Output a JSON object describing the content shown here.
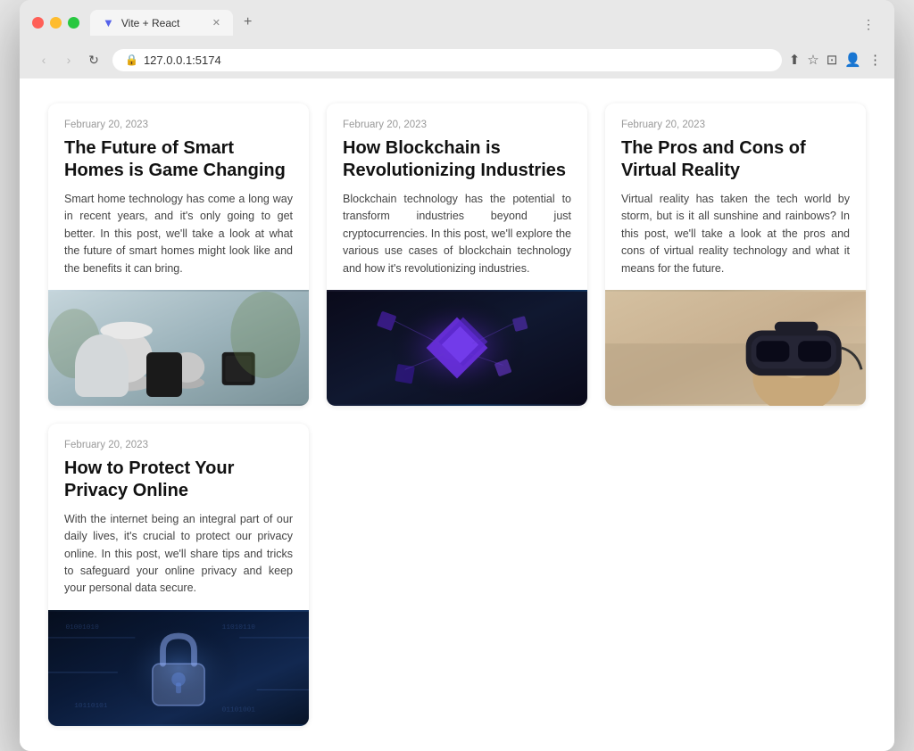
{
  "browser": {
    "tab_title": "Vite + React",
    "tab_favicon": "▼",
    "url": "127.0.0.1:5174",
    "protocol_icon": "🔒",
    "new_tab_label": "+",
    "more_options_label": "⋮"
  },
  "nav": {
    "back_label": "‹",
    "forward_label": "›",
    "refresh_label": "↻"
  },
  "toolbar": {
    "share_label": "⬆",
    "bookmark_label": "☆",
    "split_view_label": "⊡",
    "profile_label": "👤",
    "overflow_label": "⋮"
  },
  "posts": [
    {
      "date": "February 20, 2023",
      "title": "The Future of Smart Homes is Game Changing",
      "excerpt": "Smart home technology has come a long way in recent years, and it's only going to get better. In this post, we'll take a look at what the future of smart homes might look like and the benefits it can bring.",
      "image_type": "smart-home"
    },
    {
      "date": "February 20, 2023",
      "title": "How Blockchain is Revolutionizing Industries",
      "excerpt": "Blockchain technology has the potential to transform industries beyond just cryptocurrencies. In this post, we'll explore the various use cases of blockchain technology and how it's revolutionizing industries.",
      "image_type": "blockchain"
    },
    {
      "date": "February 20, 2023",
      "title": "The Pros and Cons of Virtual Reality",
      "excerpt": "Virtual reality has taken the tech world by storm, but is it all sunshine and rainbows? In this post, we'll take a look at the pros and cons of virtual reality technology and what it means for the future.",
      "image_type": "vr"
    },
    {
      "date": "February 20, 2023",
      "title": "How to Protect Your Privacy Online",
      "excerpt": "With the internet being an integral part of our daily lives, it's crucial to protect our privacy online. In this post, we'll share tips and tricks to safeguard your online privacy and keep your personal data secure.",
      "image_type": "privacy"
    }
  ]
}
